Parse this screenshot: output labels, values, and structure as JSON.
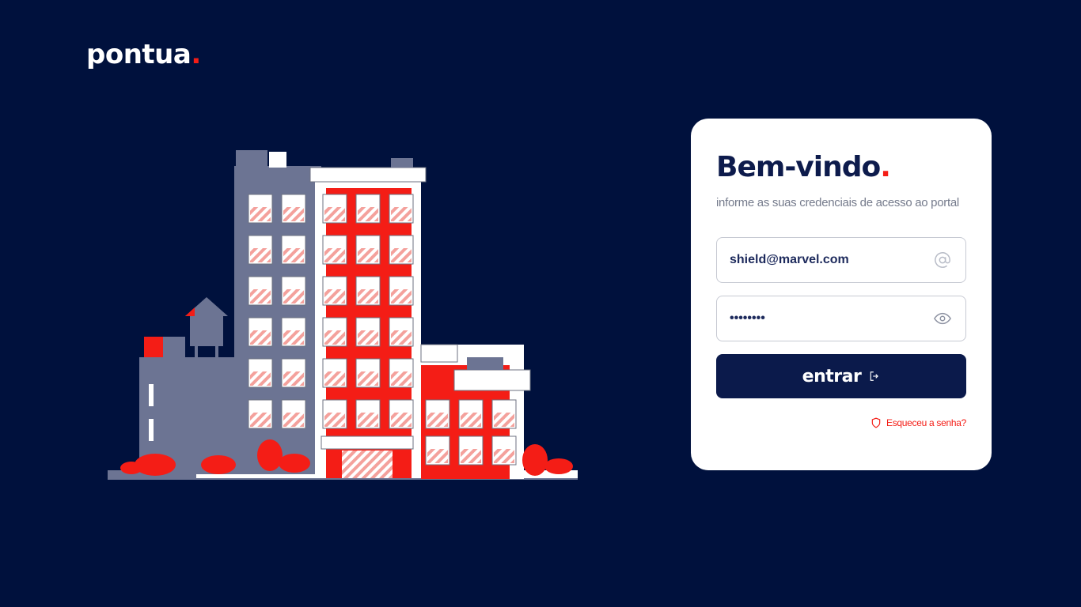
{
  "brand": {
    "name": "pontua",
    "accent": "#f41d16",
    "background": "#00113d"
  },
  "login": {
    "title": "Bem-vindo",
    "title_dot": ".",
    "subtitle": "informe as suas credenciais de acesso ao portal",
    "email": {
      "value": "shield@marvel.com",
      "icon": "at-icon"
    },
    "password": {
      "value": "••••••••",
      "icon": "eye-icon"
    },
    "submit_label": "entrar",
    "submit_icon": "sign-in-icon",
    "forgot_label": "Esqueceu a senha?",
    "forgot_icon": "shield-icon"
  }
}
